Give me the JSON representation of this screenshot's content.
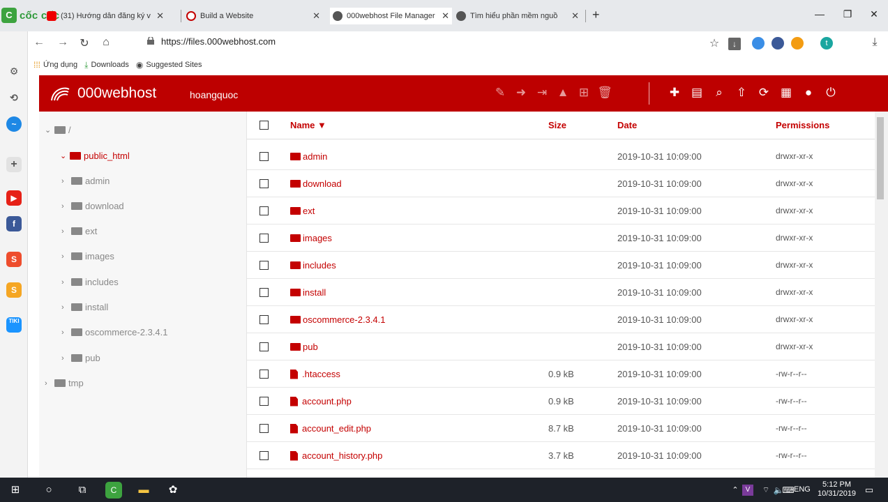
{
  "browser": {
    "brand": "cốc cốc",
    "tabs": [
      {
        "title": "(31) Hướng dẫn đăng ký v",
        "active": false
      },
      {
        "title": "Build a Website",
        "active": false
      },
      {
        "title": "000webhost File Manager",
        "active": true
      },
      {
        "title": "Tìm hiểu phần mềm nguồ",
        "active": false
      }
    ],
    "url": "https://files.000webhost.com",
    "bookmarks": [
      "Ứng dụng",
      "Downloads",
      "Suggested Sites"
    ],
    "profile_initial": "t"
  },
  "app": {
    "brand": "000webhost",
    "user": "hoangquoc",
    "accent": "#bd0000"
  },
  "tree": {
    "root": "/",
    "public_html": "public_html",
    "children": [
      "admin",
      "download",
      "ext",
      "images",
      "includes",
      "install",
      "oscommerce-2.3.4.1",
      "pub"
    ],
    "tmp": "tmp"
  },
  "table": {
    "columns": {
      "name": "Name ▼",
      "size": "Size",
      "date": "Date",
      "permissions": "Permissions"
    },
    "rows": [
      {
        "name": "admin",
        "type": "folder",
        "size": "",
        "date": "2019-10-31 10:09:00",
        "perm": "drwxr-xr-x"
      },
      {
        "name": "download",
        "type": "folder",
        "size": "",
        "date": "2019-10-31 10:09:00",
        "perm": "drwxr-xr-x"
      },
      {
        "name": "ext",
        "type": "folder",
        "size": "",
        "date": "2019-10-31 10:09:00",
        "perm": "drwxr-xr-x"
      },
      {
        "name": "images",
        "type": "folder",
        "size": "",
        "date": "2019-10-31 10:09:00",
        "perm": "drwxr-xr-x"
      },
      {
        "name": "includes",
        "type": "folder",
        "size": "",
        "date": "2019-10-31 10:09:00",
        "perm": "drwxr-xr-x"
      },
      {
        "name": "install",
        "type": "folder",
        "size": "",
        "date": "2019-10-31 10:09:00",
        "perm": "drwxr-xr-x"
      },
      {
        "name": "oscommerce-2.3.4.1",
        "type": "folder",
        "size": "",
        "date": "2019-10-31 10:09:00",
        "perm": "drwxr-xr-x"
      },
      {
        "name": "pub",
        "type": "folder",
        "size": "",
        "date": "2019-10-31 10:09:00",
        "perm": "drwxr-xr-x"
      },
      {
        "name": ".htaccess",
        "type": "file",
        "size": "0.9 kB",
        "date": "2019-10-31 10:09:00",
        "perm": "-rw-r--r--"
      },
      {
        "name": "account.php",
        "type": "file",
        "size": "0.9 kB",
        "date": "2019-10-31 10:09:00",
        "perm": "-rw-r--r--"
      },
      {
        "name": "account_edit.php",
        "type": "file",
        "size": "8.7 kB",
        "date": "2019-10-31 10:09:00",
        "perm": "-rw-r--r--"
      },
      {
        "name": "account_history.php",
        "type": "file",
        "size": "3.7 kB",
        "date": "2019-10-31 10:09:00",
        "perm": "-rw-r--r--"
      }
    ]
  },
  "taskbar": {
    "lang": "ENG",
    "time": "5:12 PM",
    "date": "10/31/2019"
  }
}
